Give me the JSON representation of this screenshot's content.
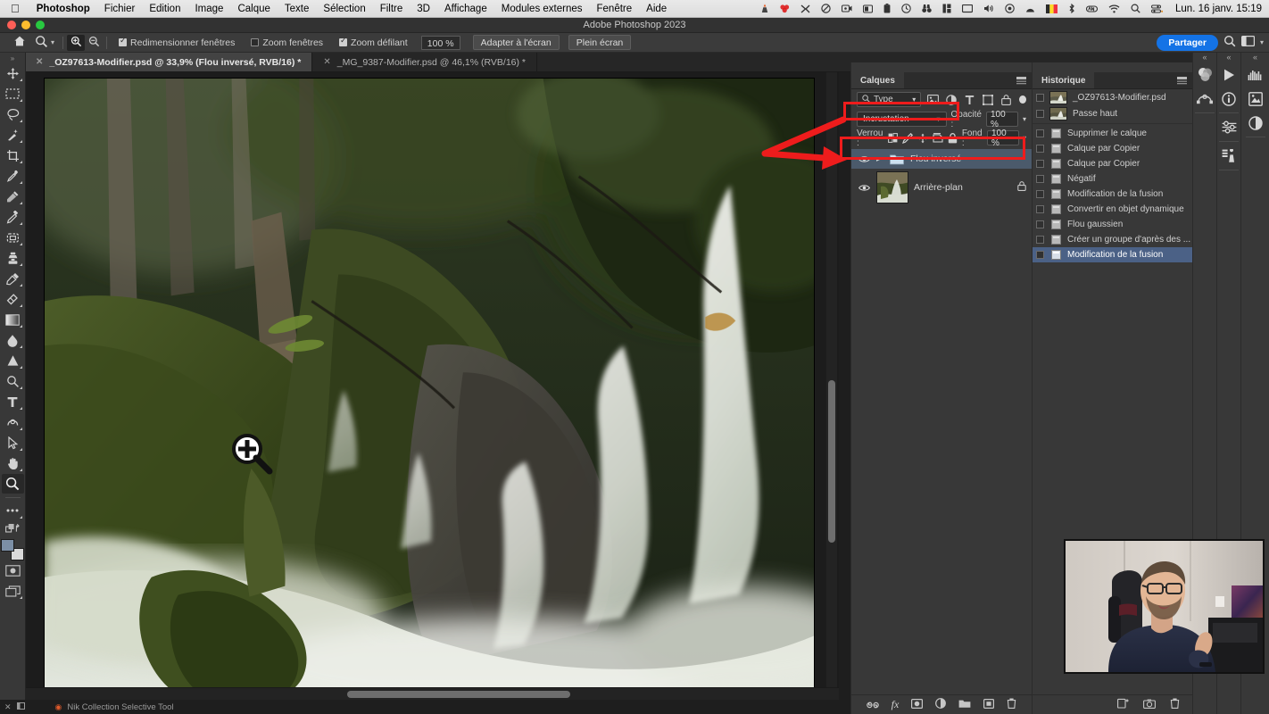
{
  "macbar": {
    "apple_icon": "apple-logo-icon",
    "menus": [
      {
        "label": "Photoshop",
        "bold": true
      },
      {
        "label": "Fichier",
        "bold": false
      },
      {
        "label": "Edition",
        "bold": false
      },
      {
        "label": "Image",
        "bold": false
      },
      {
        "label": "Calque",
        "bold": false
      },
      {
        "label": "Texte",
        "bold": false
      },
      {
        "label": "Sélection",
        "bold": false
      },
      {
        "label": "Filtre",
        "bold": false
      },
      {
        "label": "3D",
        "bold": false
      },
      {
        "label": "Affichage",
        "bold": false
      },
      {
        "label": "Modules externes",
        "bold": false
      },
      {
        "label": "Fenêtre",
        "bold": false
      },
      {
        "label": "Aide",
        "bold": false
      }
    ],
    "status_icons": [
      "vlc-icon",
      "adobe-cc-icon",
      "wacom-icon",
      "dnd-icon",
      "screen-record-icon",
      "camera-app-icon",
      "battery-icon",
      "timemachine-icon",
      "binoculars-icon",
      "stats-icon",
      "display-icon",
      "volume-icon",
      "record-icon",
      "arc-icon",
      "belgium-flag-icon",
      "bluetooth-icon",
      "vpn-icon",
      "wifi-icon",
      "spotlight-search-icon",
      "control-center-icon"
    ],
    "clock": "Lun. 16 janv.  15:19"
  },
  "titlebar": {
    "app_title": "Adobe Photoshop 2023"
  },
  "optionsbar": {
    "home_icon": "home-icon",
    "tool_icon": "zoom-tool-icon",
    "tool_caret": "chevron-down-icon",
    "zoom_in_icon": "zoom-in-icon",
    "zoom_out_icon": "zoom-out-icon",
    "checkboxes": [
      {
        "label": "Redimensionner fenêtres",
        "checked": true
      },
      {
        "label": "Zoom fenêtres",
        "checked": false
      },
      {
        "label": "Zoom défilant",
        "checked": true
      }
    ],
    "zoom_value": "100 %",
    "fit_screen_label": "Adapter à l'écran",
    "fullscreen_label": "Plein écran",
    "share_label": "Partager",
    "search_icon": "search-icon",
    "workspace_icon": "workspace-icon",
    "workspace_caret": "chevron-down-icon"
  },
  "tabs": [
    {
      "label": "_OZ97613-Modifier.psd @ 33,9% (Flou inversé, RVB/16) *",
      "active": true,
      "close_icon": "close-icon"
    },
    {
      "label": "_MG_9387-Modifier.psd @ 46,1% (RVB/16) *",
      "active": false,
      "close_icon": "close-icon"
    }
  ],
  "toolbar": {
    "collapse_icon": "double-chevron-icon",
    "tools": [
      {
        "name": "move-tool",
        "icon": "move-icon",
        "selected": false
      },
      {
        "name": "rectangular-marquee-tool",
        "icon": "marquee-icon",
        "selected": false
      },
      {
        "name": "lasso-tool",
        "icon": "lasso-icon",
        "selected": false
      },
      {
        "name": "quick-selection-tool",
        "icon": "magic-wand-icon",
        "selected": false
      },
      {
        "name": "crop-tool",
        "icon": "crop-icon",
        "selected": false
      },
      {
        "name": "eyedropper-tool",
        "icon": "eyedropper-icon",
        "selected": false
      },
      {
        "name": "spot-healing-tool",
        "icon": "healing-brush-icon",
        "selected": false
      },
      {
        "name": "brush-tool",
        "icon": "brush-icon",
        "selected": false
      },
      {
        "name": "patch-tool",
        "icon": "patch-icon",
        "selected": false
      },
      {
        "name": "clone-stamp-tool",
        "icon": "clone-stamp-icon",
        "selected": false
      },
      {
        "name": "history-brush-tool",
        "icon": "history-brush-icon",
        "selected": false
      },
      {
        "name": "eraser-tool",
        "icon": "eraser-icon",
        "selected": false
      },
      {
        "name": "gradient-tool",
        "icon": "gradient-icon",
        "selected": false
      },
      {
        "name": "blur-tool",
        "icon": "blur-drop-icon",
        "selected": false
      },
      {
        "name": "dodge-tool",
        "icon": "dodge-icon",
        "selected": false
      },
      {
        "name": "pen-tool",
        "icon": "pen-icon",
        "selected": false
      },
      {
        "name": "type-tool",
        "icon": "type-t-icon",
        "selected": false
      },
      {
        "name": "path-selection-tool",
        "icon": "path-select-icon",
        "selected": false
      },
      {
        "name": "shape-tool",
        "icon": "arrow-select-icon",
        "selected": false
      },
      {
        "name": "hand-tool",
        "icon": "hand-icon",
        "selected": false
      },
      {
        "name": "zoom-tool",
        "icon": "magnifier-icon",
        "selected": true
      },
      {
        "name": "edit-toolbar",
        "icon": "ellipsis-icon",
        "selected": false
      }
    ],
    "swap_colors_icon": "swap-colors-icon",
    "default_colors_icon": "default-colors-icon",
    "foreground_color": "#7c8fa6",
    "background_color": "#d9d9d9",
    "quickmask_icon": "quick-mask-icon",
    "screenmode_icon": "screen-mode-icon"
  },
  "layers_panel": {
    "tab_label": "Calques",
    "menu_icon": "panel-menu-icon",
    "filter": {
      "search_icon": "search-icon",
      "value": "Type",
      "caret_icon": "chevron-down-icon",
      "type_icons": [
        "pixel-filter-icon",
        "adjustment-filter-icon",
        "type-filter-icon",
        "shape-filter-icon",
        "smartobject-filter-icon"
      ],
      "toggle_icon": "filter-power-toggle"
    },
    "blend_mode": "Incrustation",
    "blend_caret": "chevron-down-icon",
    "opacity_label": "Opacité :",
    "opacity_value": "100 %",
    "opacity_caret": "chevron-down-icon",
    "lock_label": "Verrou :",
    "lock_icons": [
      "lock-transparency-icon",
      "lock-image-icon",
      "lock-position-icon",
      "lock-artboard-icon",
      "lock-all-icon"
    ],
    "fill_label": "Fond :",
    "fill_value": "100 %",
    "fill_caret": "chevron-down-icon",
    "layers": [
      {
        "name": "Flou inversé",
        "type": "group",
        "selected": true,
        "visible": true,
        "eye_icon": "eye-icon",
        "expand_icon": "chevron-right-icon",
        "folder_icon": "folder-icon",
        "locked": false
      },
      {
        "name": "Arrière-plan",
        "type": "image",
        "selected": false,
        "visible": true,
        "eye_icon": "eye-icon",
        "thumbnail": "waterfall-thumbnail",
        "locked": true,
        "lock_icon": "lock-icon"
      }
    ],
    "bottom_icons": [
      "link-layers-icon",
      "layer-style-fx-icon",
      "add-mask-icon",
      "adjustment-layer-icon",
      "new-group-icon",
      "new-layer-icon",
      "delete-layer-icon"
    ]
  },
  "history_panel": {
    "tab_label": "Historique",
    "menu_icon": "panel-menu-icon",
    "snapshots": [
      {
        "label": "_OZ97613-Modifier.psd",
        "thumb": "waterfall-thumbnail"
      },
      {
        "label": "Passe haut",
        "thumb": "waterfall-thumbnail"
      }
    ],
    "states": [
      {
        "label": "Supprimer le calque",
        "selected": false,
        "icon": "history-state-icon"
      },
      {
        "label": "Calque par Copier",
        "selected": false,
        "icon": "history-state-icon"
      },
      {
        "label": "Calque par Copier",
        "selected": false,
        "icon": "history-state-icon"
      },
      {
        "label": "Négatif",
        "selected": false,
        "icon": "history-state-icon"
      },
      {
        "label": "Modification de la fusion",
        "selected": false,
        "icon": "history-state-icon"
      },
      {
        "label": "Convertir en objet dynamique",
        "selected": false,
        "icon": "history-state-icon"
      },
      {
        "label": "Flou gaussien",
        "selected": false,
        "icon": "history-state-icon"
      },
      {
        "label": "Créer un groupe d'après des ...",
        "selected": false,
        "icon": "history-state-icon"
      },
      {
        "label": "Modification de la fusion",
        "selected": true,
        "icon": "history-state-icon"
      }
    ],
    "bottom_icons": [
      "create-document-from-state-icon",
      "new-snapshot-icon",
      "delete-state-icon"
    ]
  },
  "right_rails": [
    {
      "name": "rail-color",
      "collapse_icon": "double-chevron-left-icon",
      "icons": [
        "color-wheel-icon",
        "paths-icon"
      ]
    },
    {
      "name": "rail-actions",
      "collapse_icon": "double-chevron-left-icon",
      "icons": [
        "play-actions-icon",
        "info-icon",
        "adjustments-sliders-icon",
        "layer-comps-icon"
      ]
    },
    {
      "name": "rail-extra",
      "collapse_icon": "double-chevron-left-icon",
      "icons": [
        "histogram-icon",
        "libraries-icon",
        "adjustments-circle-icon"
      ]
    }
  ],
  "statusbar": {
    "close_icon": "close-icon",
    "panel_icon": "panel-icon",
    "plugin_dot": "orange-dot-icon",
    "plugin_label": "Nik Collection Selective Tool"
  },
  "annotations": {
    "arrow_color": "#ee1c1c",
    "highlight_color": "#ee1c1c",
    "arrow_name": "red-annotation-arrow",
    "box_blend_name": "red-highlight-blend-mode",
    "box_layer_name": "red-highlight-layer-row"
  },
  "cursor": {
    "icon": "zoom-in-cursor"
  },
  "webcam": {
    "name": "webcam-overlay"
  },
  "canvas": {
    "document_name": "waterfall-photo-canvas"
  }
}
